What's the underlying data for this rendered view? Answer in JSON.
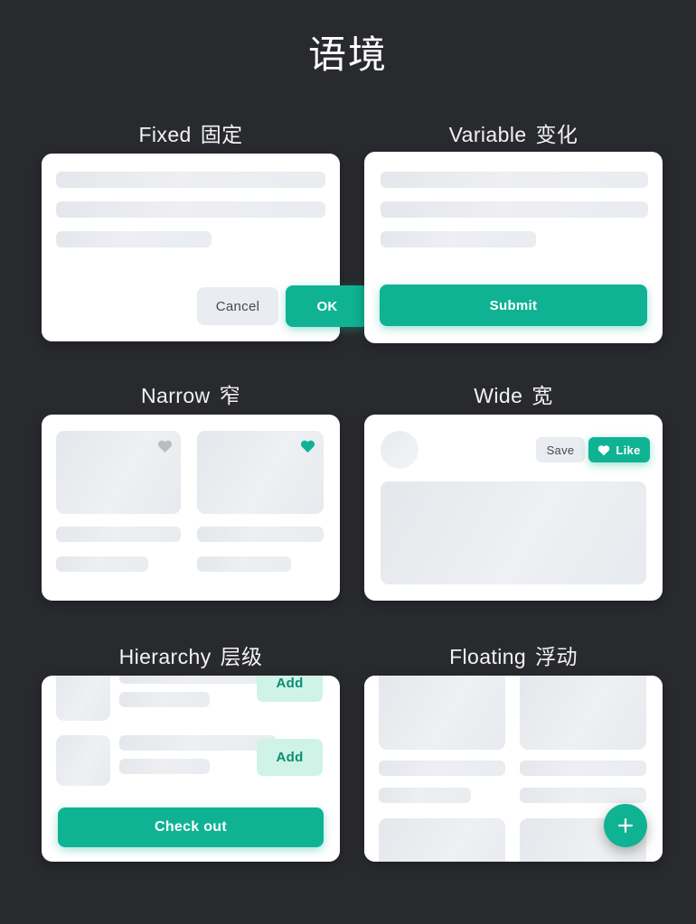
{
  "page": {
    "title": "语境",
    "background_color": "#292A2E",
    "accent_color": "#0FB394",
    "accent_soft_color": "#CFF3E7",
    "surface_color": "#FFFFFF",
    "skeleton_color": "#E7EAEE"
  },
  "sections": [
    {
      "id": "fixed",
      "label_en": "Fixed",
      "label_cjk": "固定",
      "buttons": {
        "cancel": "Cancel",
        "ok": "OK"
      }
    },
    {
      "id": "variable",
      "label_en": "Variable",
      "label_cjk": "变化",
      "buttons": {
        "submit": "Submit"
      }
    },
    {
      "id": "narrow",
      "label_en": "Narrow",
      "label_cjk": "窄",
      "icons": {
        "heart_inactive": "heart-icon",
        "heart_active": "heart-icon"
      }
    },
    {
      "id": "wide",
      "label_en": "Wide",
      "label_cjk": "宽",
      "buttons": {
        "save": "Save",
        "like": "Like"
      }
    },
    {
      "id": "hierarchy",
      "label_en": "Hierarchy",
      "label_cjk": "层级",
      "buttons": {
        "add_1": "Add",
        "add_2": "Add",
        "checkout": "Check out"
      }
    },
    {
      "id": "floating",
      "label_en": "Floating",
      "label_cjk": "浮动",
      "buttons": {
        "fab": "plus-icon"
      }
    }
  ]
}
